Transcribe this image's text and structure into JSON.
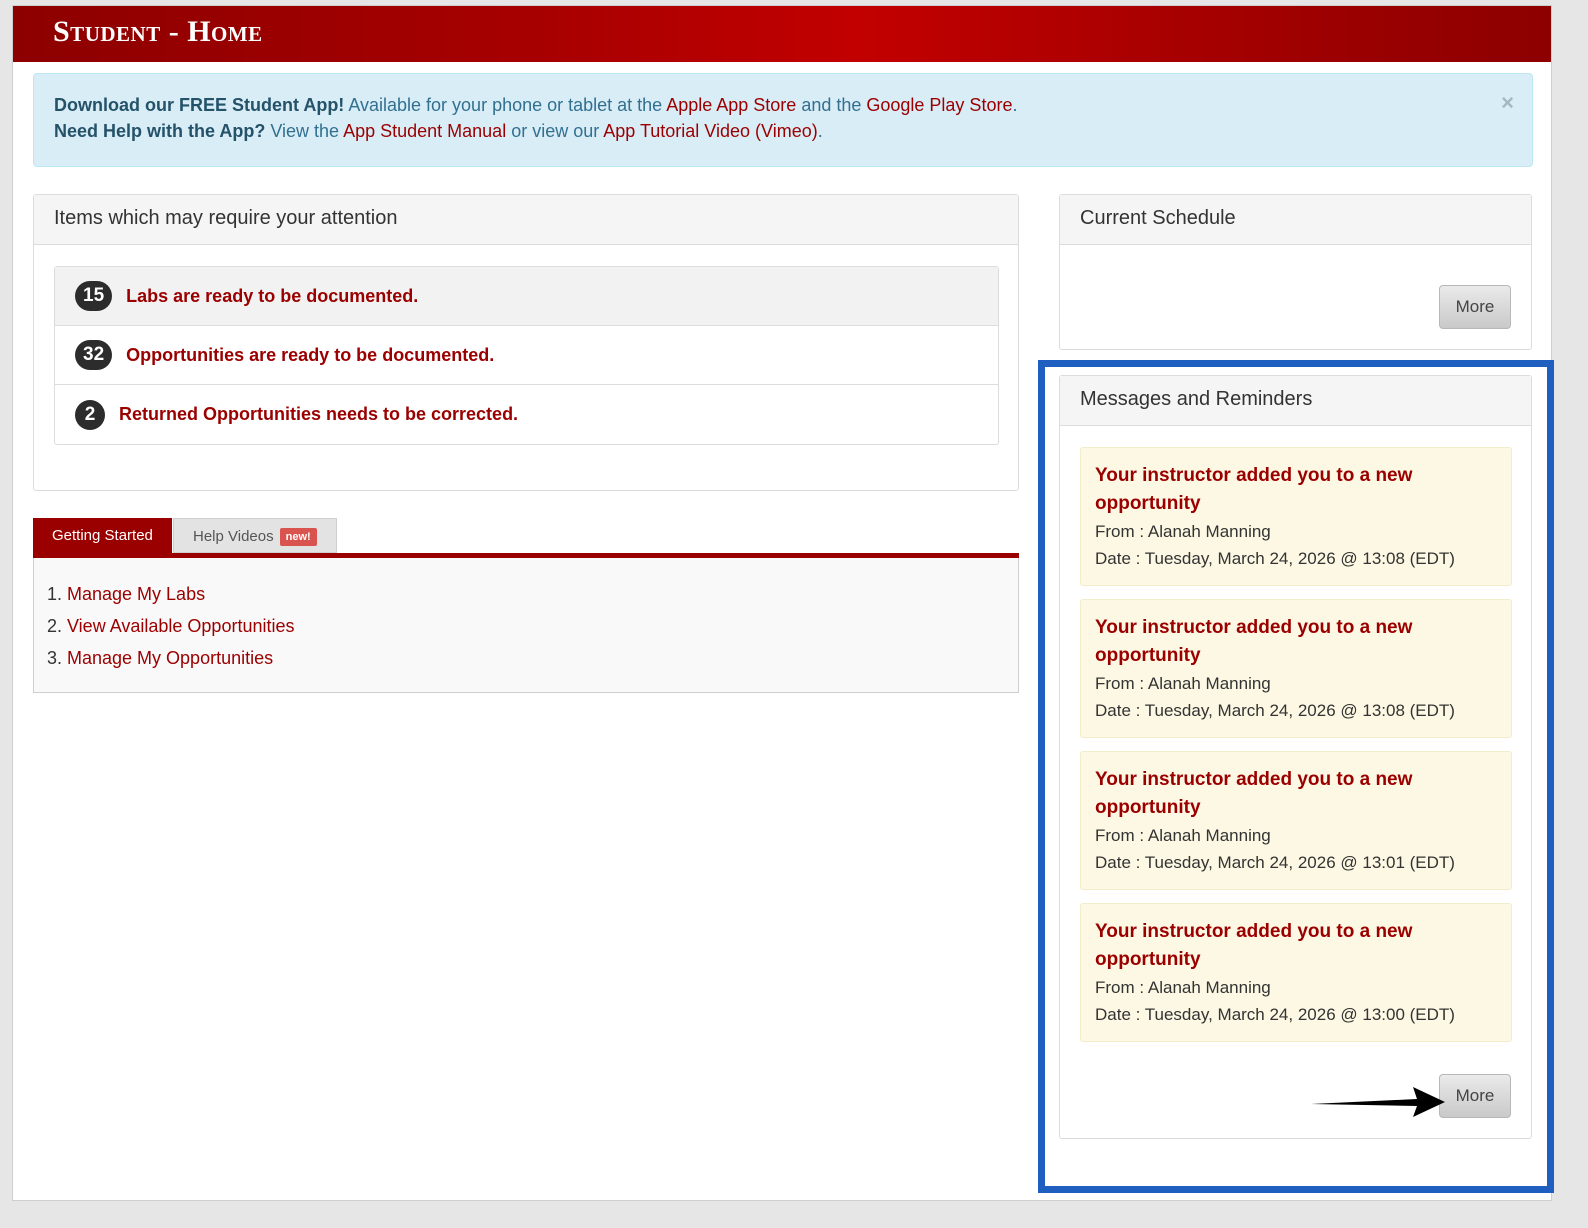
{
  "page": {
    "title": "Student - Home"
  },
  "alert": {
    "line1_bold": "Download our FREE Student App!",
    "line1_text_a": " Available for your phone or tablet at the ",
    "apple_link": "Apple App Store",
    "line1_text_b": " and the ",
    "google_link": "Google Play Store",
    "line1_end": ".",
    "line2_bold": "Need Help with the App?",
    "line2_text_a": " View the ",
    "manual_link": "App Student Manual",
    "line2_text_b": " or view our ",
    "video_link": "App Tutorial Video (Vimeo)",
    "line2_end": ".",
    "close": "×"
  },
  "attention": {
    "heading": "Items which may require your attention",
    "items": [
      {
        "count": "15",
        "text": "Labs are ready to be documented."
      },
      {
        "count": "32",
        "text": "Opportunities are ready to be documented."
      },
      {
        "count": "2",
        "text": "Returned Opportunities needs to be corrected."
      }
    ]
  },
  "tabs": {
    "active": "Getting Started",
    "inactive": "Help Videos",
    "new_badge": "new!",
    "links": [
      "Manage My Labs",
      "View Available Opportunities",
      "Manage My Opportunities"
    ]
  },
  "schedule": {
    "heading": "Current Schedule",
    "more": "More"
  },
  "messages": {
    "heading": "Messages and Reminders",
    "more": "More",
    "items": [
      {
        "title_l1": "Your instructor added you to a new",
        "title_l2": "opportunity",
        "from": "From : Alanah Manning",
        "date": "Date : Tuesday, March 24, 2026 @ 13:08 (EDT)"
      },
      {
        "title_l1": "Your instructor added you to a new",
        "title_l2": "opportunity",
        "from": "From : Alanah Manning",
        "date": "Date : Tuesday, March 24, 2026 @ 13:08 (EDT)"
      },
      {
        "title_l1": "Your instructor added you to a new",
        "title_l2": "opportunity",
        "from": "From : Alanah Manning",
        "date": "Date : Tuesday, March 24, 2026 @ 13:01 (EDT)"
      },
      {
        "title_l1": "Your instructor added you to a new",
        "title_l2": "opportunity",
        "from": "From : Alanah Manning",
        "date": "Date : Tuesday, March 24, 2026 @ 13:00 (EDT)"
      }
    ]
  },
  "colors": {
    "brand_red": "#9b0000",
    "highlight_blue": "#1f5fbf",
    "alert_bg": "#d9edf7",
    "message_bg": "#fcf8e3"
  }
}
